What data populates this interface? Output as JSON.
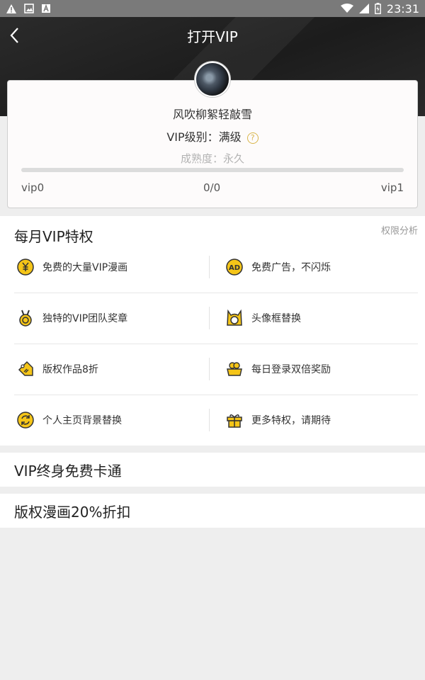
{
  "status_bar": {
    "time": "23:31",
    "icons": [
      "warning-icon",
      "image-icon",
      "font-icon",
      "wifi-icon",
      "signal-icon",
      "battery-icon"
    ]
  },
  "header": {
    "title": "打开VIP",
    "back_icon": "back-arrow-icon",
    "background_color": "#1f1f1f"
  },
  "profile": {
    "username": "风吹柳絮轻敲雪",
    "vip_level": "VIP级别：满级",
    "maturity": "成熟度：永久",
    "progress_fraction": 0,
    "progress_text": "0/0",
    "level_start": "vip0",
    "level_end": "vip1",
    "accent_color": "#d9b54a"
  },
  "monthly": {
    "title": "每月VIP特权",
    "link": "权限分析",
    "perks": [
      {
        "label": "免费的大量VIP漫画",
        "icon": "yen-coin-icon"
      },
      {
        "label": "免费广告，不闪烁",
        "icon": "ad-icon"
      },
      {
        "label": "独特的VIP团队奖章",
        "icon": "medal-icon"
      },
      {
        "label": "头像框替换",
        "icon": "avatar-frame-icon"
      },
      {
        "label": "版权作品8折",
        "icon": "discount-tag-icon"
      },
      {
        "label": "每日登录双倍奖励",
        "icon": "double-reward-icon"
      },
      {
        "label": "个人主页背景替换",
        "icon": "refresh-icon"
      },
      {
        "label": "更多特权，请期待",
        "icon": "gift-icon"
      }
    ]
  },
  "sections": [
    {
      "label": "VIP终身免费卡通"
    },
    {
      "label": "版权漫画20%折扣"
    }
  ]
}
